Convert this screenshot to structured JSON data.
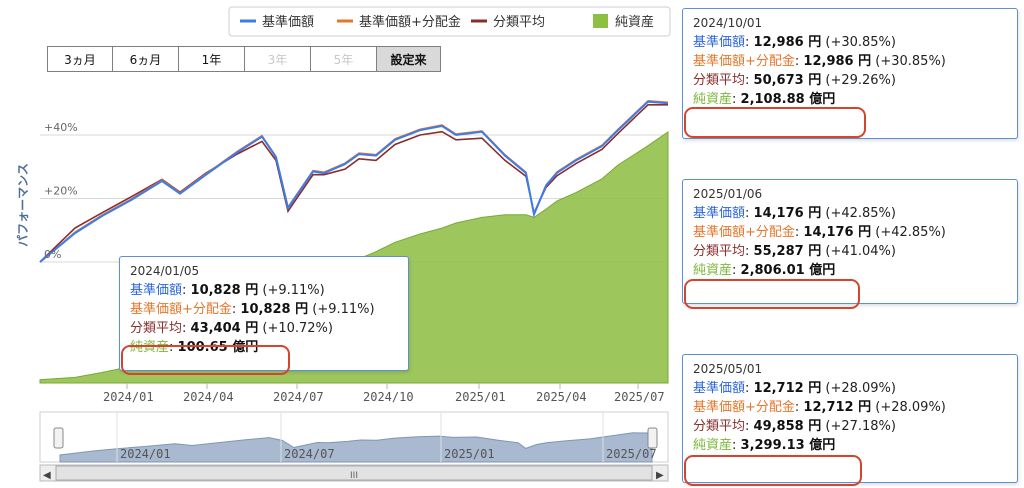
{
  "range_buttons": [
    {
      "label": "3ヵ月",
      "state": "normal"
    },
    {
      "label": "6ヵ月",
      "state": "normal"
    },
    {
      "label": "1年",
      "state": "normal"
    },
    {
      "label": "3年",
      "state": "disabled"
    },
    {
      "label": "5年",
      "state": "disabled"
    },
    {
      "label": "設定来",
      "state": "active"
    }
  ],
  "chart_data": {
    "type": "line",
    "ylabel": "パフォーマンス",
    "y_ticks": [
      "0%",
      "+20%",
      "+40%"
    ],
    "ylim": [
      0,
      55
    ],
    "x_ticks": [
      "2024/01",
      "2024/04",
      "2024/07",
      "2024/10",
      "2025/01",
      "2025/04",
      "2025/07"
    ],
    "legend_position": "top",
    "series": [
      {
        "name": "基準価額",
        "color": "#3b7de8",
        "axis": "percent"
      },
      {
        "name": "基準価額+分配金",
        "color": "#e5762b",
        "axis": "percent"
      },
      {
        "name": "分類平均",
        "color": "#8a2d2d",
        "axis": "percent"
      },
      {
        "name": "純資産",
        "color": "#8dbf43",
        "axis": "assets",
        "type": "area"
      }
    ],
    "x": [
      "2023/12/01",
      "2024/01/05",
      "2024/02/01",
      "2024/03/01",
      "2024/04/01",
      "2024/04/19",
      "2024/05/15",
      "2024/06/15",
      "2024/07/10",
      "2024/07/24",
      "2024/08/05",
      "2024/08/30",
      "2024/09/10",
      "2024/10/01",
      "2024/10/15",
      "2024/11/01",
      "2024/11/20",
      "2024/12/15",
      "2025/01/06",
      "2025/01/20",
      "2025/02/15",
      "2025/03/10",
      "2025/03/31",
      "2025/04/08",
      "2025/04/20",
      "2025/05/01",
      "2025/05/20",
      "2025/06/15",
      "2025/07/01",
      "2025/07/31",
      "2025/08/20"
    ],
    "base_value_pct": [
      0,
      9.11,
      14.5,
      19.5,
      25.5,
      21.5,
      27.5,
      34.5,
      39.5,
      33.0,
      17.0,
      28.5,
      28.0,
      30.85,
      34.0,
      33.5,
      38.5,
      41.5,
      42.85,
      40.0,
      41.0,
      33.5,
      28.0,
      15.0,
      24.0,
      28.09,
      32.0,
      36.5,
      41.5,
      50.5,
      50.0
    ],
    "category_avg_pct": [
      0,
      10.72,
      15.5,
      20.5,
      26.0,
      22.0,
      28.0,
      34.0,
      38.0,
      32.0,
      16.0,
      27.5,
      27.5,
      29.26,
      32.5,
      32.0,
      37.0,
      40.0,
      41.04,
      38.5,
      39.0,
      32.0,
      27.0,
      15.5,
      23.5,
      27.18,
      31.0,
      35.5,
      40.5,
      49.5,
      49.5
    ],
    "net_assets_oku": [
      60,
      100.65,
      190,
      300,
      420,
      460,
      600,
      800,
      1000,
      1100,
      1150,
      1320,
      1500,
      2108.88,
      2250,
      2380,
      2550,
      2700,
      2806.01,
      2900,
      3000,
      3050,
      3050,
      3000,
      3150,
      3299.13,
      3450,
      3700,
      3950,
      4300,
      4550
    ],
    "assets_max": 5400
  },
  "navigator": {
    "labels": [
      "2024/01",
      "2024/07",
      "2025/01",
      "2025/07"
    ],
    "scroll_grip": "III",
    "left_arrow": "◀",
    "right_arrow": "▶"
  },
  "tooltips": [
    {
      "date": "2024/01/05",
      "rows": [
        {
          "key": "基準価額",
          "color": "#2b65d9",
          "value": "10,828 円",
          "change": "(+9.11%)"
        },
        {
          "key": "基準価額+分配金",
          "color": "#e5762b",
          "value": "10,828 円",
          "change": "(+9.11%)"
        },
        {
          "key": "分類平均",
          "color": "#8a2d2d",
          "value": "43,404 円",
          "change": "(+10.72%)"
        },
        {
          "key": "純資産",
          "color": "#7bb73a",
          "value": "100.65 億円",
          "change": ""
        }
      ]
    },
    {
      "date": "2024/10/01",
      "rows": [
        {
          "key": "基準価額",
          "color": "#2b65d9",
          "value": "12,986 円",
          "change": "(+30.85%)"
        },
        {
          "key": "基準価額+分配金",
          "color": "#e5762b",
          "value": "12,986 円",
          "change": "(+30.85%)"
        },
        {
          "key": "分類平均",
          "color": "#8a2d2d",
          "value": "50,673 円",
          "change": "(+29.26%)"
        },
        {
          "key": "純資産",
          "color": "#7bb73a",
          "value": "2,108.88 億円",
          "change": ""
        }
      ]
    },
    {
      "date": "2025/01/06",
      "rows": [
        {
          "key": "基準価額",
          "color": "#2b65d9",
          "value": "14,176 円",
          "change": "(+42.85%)"
        },
        {
          "key": "基準価額+分配金",
          "color": "#e5762b",
          "value": "14,176 円",
          "change": "(+42.85%)"
        },
        {
          "key": "分類平均",
          "color": "#8a2d2d",
          "value": "55,287 円",
          "change": "(+41.04%)"
        },
        {
          "key": "純資産",
          "color": "#7bb73a",
          "value": "2,806.01 億円",
          "change": ""
        }
      ]
    },
    {
      "date": "2025/05/01",
      "rows": [
        {
          "key": "基準価額",
          "color": "#2b65d9",
          "value": "12,712 円",
          "change": "(+28.09%)"
        },
        {
          "key": "基準価額+分配金",
          "color": "#e5762b",
          "value": "12,712 円",
          "change": "(+28.09%)"
        },
        {
          "key": "分類平均",
          "color": "#8a2d2d",
          "value": "49,858 円",
          "change": "(+27.18%)"
        },
        {
          "key": "純資産",
          "color": "#7bb73a",
          "value": "3,299.13 億円",
          "change": ""
        }
      ]
    }
  ]
}
